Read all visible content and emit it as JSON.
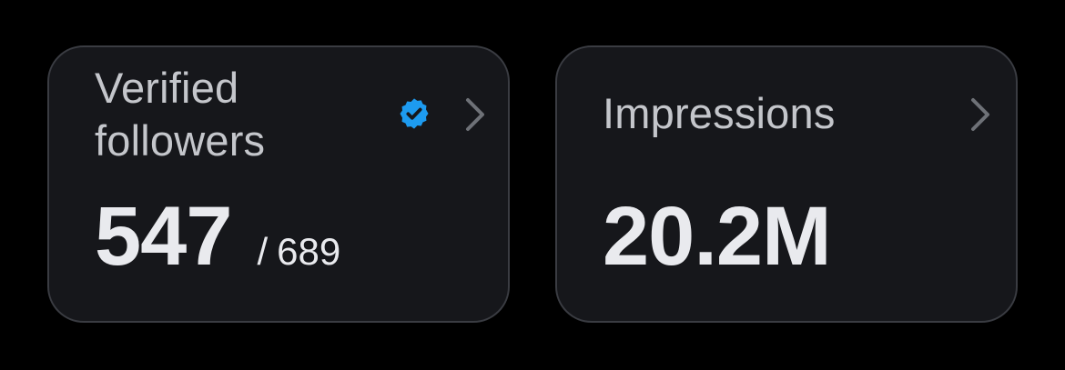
{
  "cards": [
    {
      "title": "Verified followers",
      "badge_icon": "verified-badge-icon",
      "value": "547",
      "separator": "/",
      "total": "689",
      "chevron_icon": "chevron-right-icon"
    },
    {
      "title": "Impressions",
      "value": "20.2M",
      "chevron_icon": "chevron-right-icon"
    }
  ],
  "colors": {
    "background": "#000000",
    "card_background": "#16171b",
    "card_border": "#3a3c42",
    "title_text": "#c4c6cb",
    "value_text": "#e9eaee",
    "verified_blue": "#1d9bf0",
    "chevron": "#6e7177"
  }
}
